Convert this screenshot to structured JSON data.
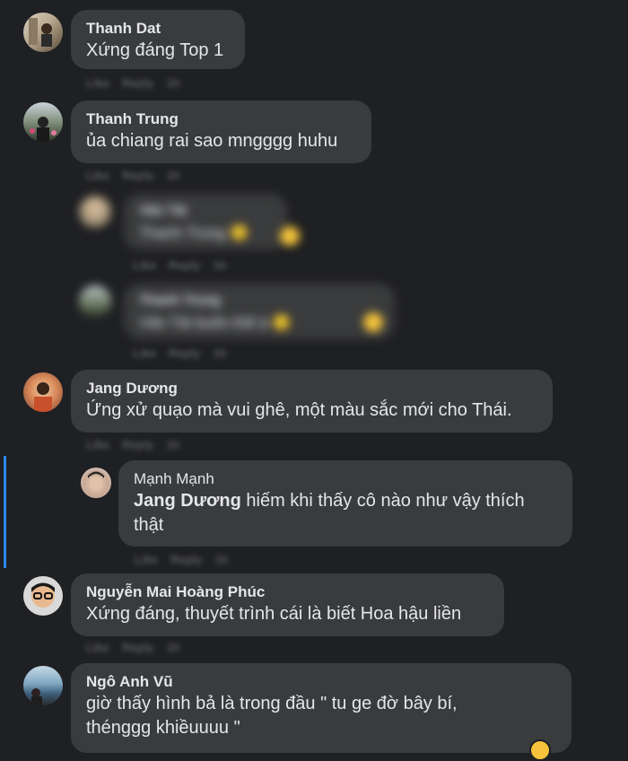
{
  "comments": [
    {
      "author": "Thanh Dat",
      "text": "Xứng đáng Top 1"
    },
    {
      "author": "Thanh Trung",
      "text": "ủa chiang rai sao mngggg huhu"
    },
    {
      "author": "Jang Dương",
      "text": "Ứng xử quạo mà vui ghê, một màu sắc mới cho Thái."
    },
    {
      "author": "Mạnh Mạnh",
      "mention": "Jang Dương",
      "text_line1": " hiếm khi thấy cô nào như vậy thích",
      "text_line2": "thật"
    },
    {
      "author": "Nguyễn Mai Hoàng Phúc",
      "text": "Xứng đáng, thuyết trình cái là biết Hoa hậu liền"
    },
    {
      "author": "Ngô Anh Vũ",
      "text_line1": "giờ thấy hình bả là trong đầu \" tu ge đờ bây bí,",
      "text_line2": "thénggg khiềuuuu \""
    }
  ],
  "actions": {
    "like": "Like",
    "reply": "Reply",
    "time": "1h"
  },
  "blurred_replies": [
    {
      "author": "Văn Tài",
      "text": "Thanh Trung 🙂"
    },
    {
      "author": "Thanh Trung",
      "text": "Văn Tài buồn thế á 🙂"
    }
  ],
  "colors": {
    "background": "#1f2023",
    "bubble": "#3a3b3c",
    "thread_line": "#2d88ff"
  }
}
